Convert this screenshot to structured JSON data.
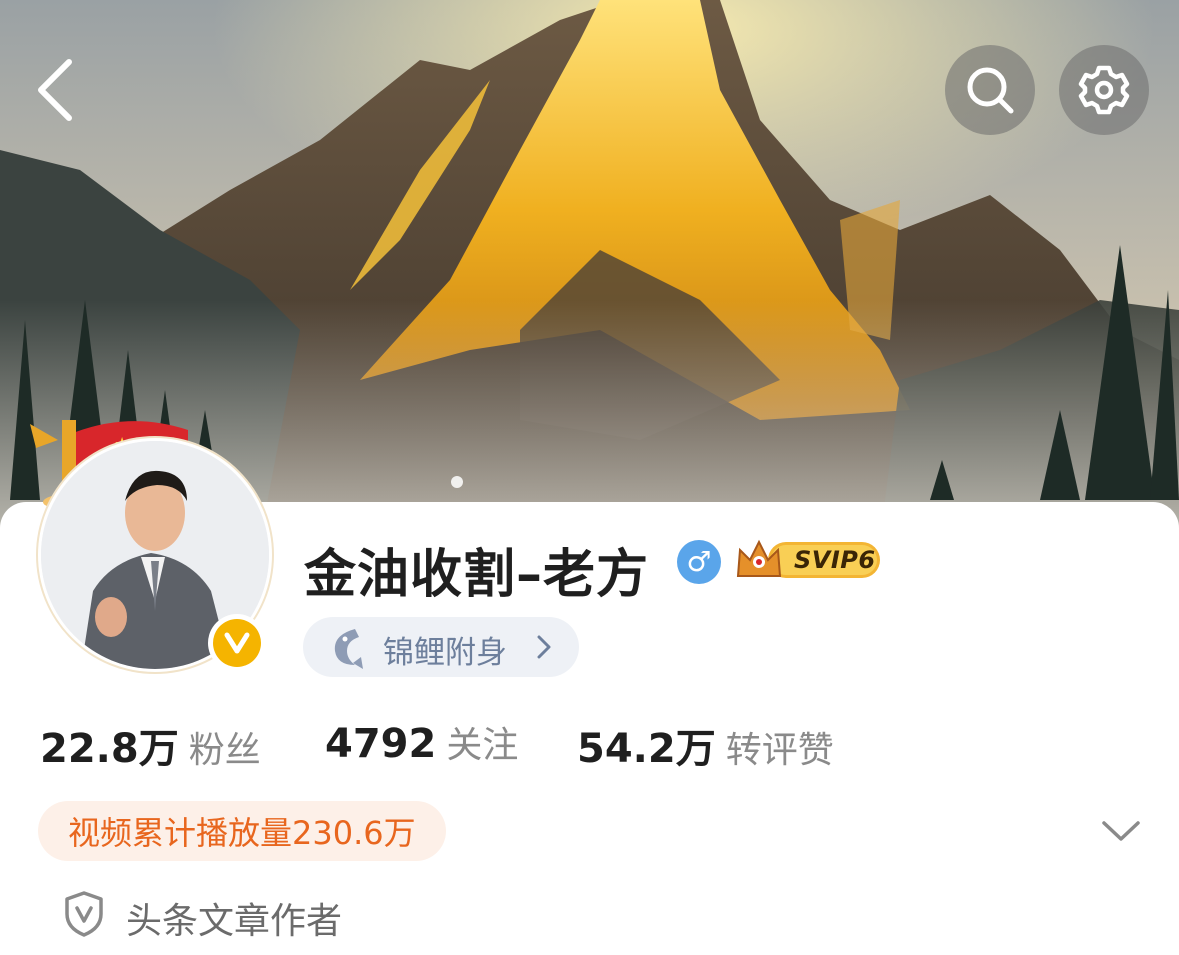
{
  "header": {
    "back_icon": "chevron-left-icon",
    "search_icon": "search-icon",
    "settings_icon": "gear-icon"
  },
  "profile": {
    "username": "金油收割–老方",
    "gender_symbol": "♂",
    "vip_label": "SVIP6",
    "carp_chip_label": "锦鲤附身",
    "carp_chip_chevron": "›"
  },
  "stats": [
    {
      "value": "22.8万",
      "label": "粉丝"
    },
    {
      "value": "4792",
      "label": "关注"
    },
    {
      "value": "54.2万",
      "label": "转评赞"
    }
  ],
  "video_badge": "视频累计播放量230.6万",
  "author_tag": "头条文章作者",
  "colors": {
    "accent_orange": "#e8661e",
    "gender_blue": "#5aa5ea",
    "verified_gold": "#f5b400"
  }
}
